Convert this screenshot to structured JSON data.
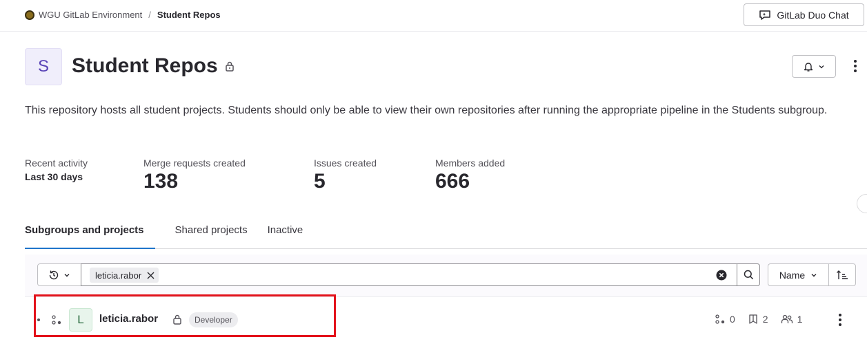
{
  "breadcrumb": {
    "org": "WGU GitLab Environment",
    "separator": "/",
    "current": "Student Repos"
  },
  "duo_chat": {
    "label": "GitLab Duo Chat",
    "icon": "duo-chat-icon"
  },
  "group": {
    "avatar_letter": "S",
    "title": "Student Repos",
    "visibility_icon": "lock-icon",
    "description": "This repository hosts all student projects. Students should only be able to view their own repositories after running the appropriate pipeline in the Students subgroup."
  },
  "stats": {
    "recent_activity_label": "Recent activity",
    "period": "Last 30 days",
    "items": [
      {
        "label": "Merge requests created",
        "value": "138"
      },
      {
        "label": "Issues created",
        "value": "5"
      },
      {
        "label": "Members added",
        "value": "666"
      }
    ]
  },
  "tabs": [
    {
      "label": "Subgroups and projects",
      "active": true
    },
    {
      "label": "Shared projects",
      "active": false
    },
    {
      "label": "Inactive",
      "active": false
    }
  ],
  "filter": {
    "token": "leticia.rabor",
    "search_value": "",
    "sort_label": "Name"
  },
  "projects": [
    {
      "avatar_letter": "L",
      "name": "leticia.rabor",
      "role": "Developer",
      "subgroups": "0",
      "projects": "2",
      "members": "1"
    }
  ],
  "colors": {
    "accent": "#1f75cb",
    "highlight": "#e3121b",
    "group_avatar": "#5943b6",
    "project_avatar": "#24663b"
  }
}
